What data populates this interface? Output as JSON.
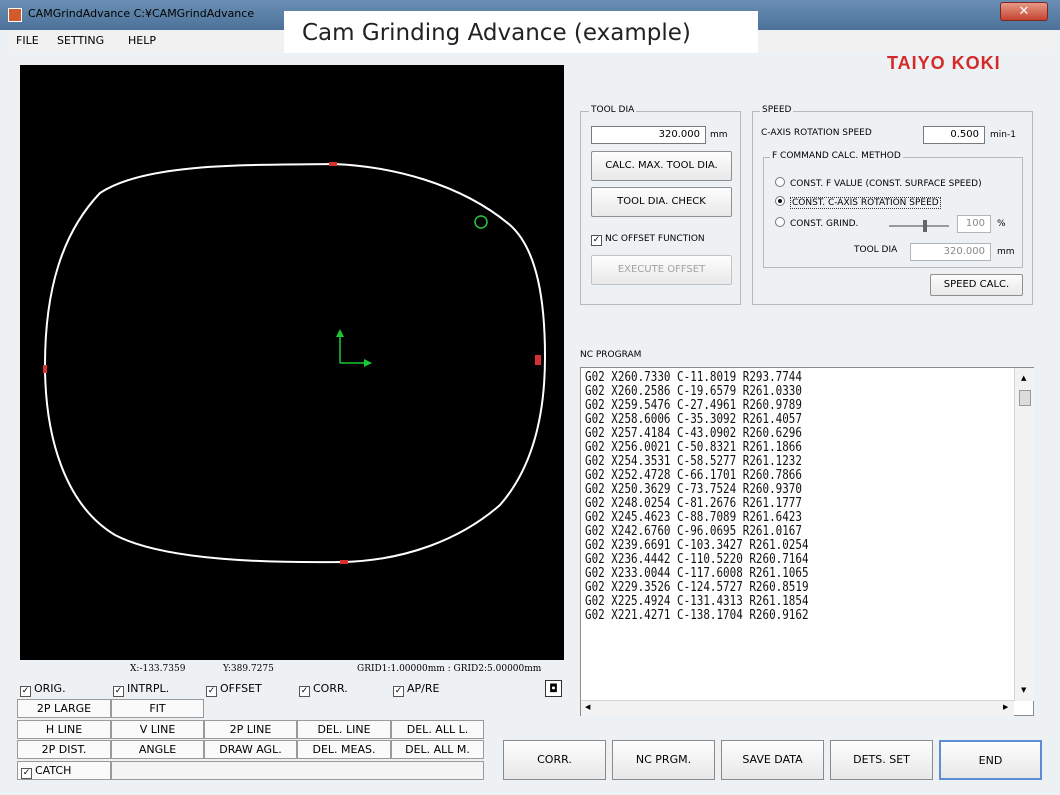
{
  "window": {
    "title": "CAMGrindAdvance  C:¥CAMGrindAdvance",
    "close_symbol": "✕",
    "caption_overlay": "Cam Grinding Advance (example)",
    "brand_logo": "TAIYO KOKI"
  },
  "menu": [
    "FILE",
    "SETTING",
    "HELP"
  ],
  "status": {
    "x": "X:-133.7359",
    "y": "Y:389.7275",
    "grid": "GRID1:1.00000mm : GRID2:5.00000mm"
  },
  "display_options": [
    {
      "label": "ORIG.",
      "checked": true
    },
    {
      "label": "INTRPL.",
      "checked": true
    },
    {
      "label": "OFFSET",
      "checked": true
    },
    {
      "label": "CORR.",
      "checked": true
    },
    {
      "label": "AP/RE",
      "checked": true
    }
  ],
  "catch": {
    "label": "CATCH",
    "checked": true
  },
  "tool_grid": {
    "row1": [
      "2P LARGE",
      "FIT"
    ],
    "row2": [
      "H LINE",
      "V LINE",
      "2P LINE",
      "DEL. LINE",
      "DEL. ALL L."
    ],
    "row3": [
      "2P DIST.",
      "ANGLE",
      "DRAW AGL.",
      "DEL. MEAS.",
      "DEL. ALL M."
    ]
  },
  "tool_dia": {
    "legend": "TOOL DIA",
    "value": "320.000",
    "unit": "mm",
    "calc_max_button": "CALC. MAX. TOOL DIA.",
    "check_button": "TOOL DIA. CHECK",
    "nc_offset_label": "NC OFFSET FUNCTION",
    "nc_offset_checked": true,
    "execute_button": "EXECUTE OFFSET"
  },
  "speed": {
    "legend": "SPEED",
    "c_axis_label": "C-AXIS ROTATION SPEED",
    "c_axis_value": "0.500",
    "c_axis_unit": "min-1",
    "method_legend": "F COMMAND CALC. METHOD",
    "options": [
      {
        "label": "CONST. F VALUE (CONST. SURFACE SPEED)",
        "selected": false
      },
      {
        "label": "CONST. C-AXIS ROTATION SPEED",
        "selected": true
      },
      {
        "label": "CONST. GRIND.",
        "selected": false
      }
    ],
    "grind_value": "100",
    "grind_unit": "%",
    "grind_level": 0.6,
    "tool_dia_label": "TOOL DIA",
    "tool_dia_value": "320.000",
    "tool_dia_unit": "mm",
    "calc_button": "SPEED CALC."
  },
  "nc_program": {
    "label": "NC PROGRAM",
    "lines": [
      "G02 X260.7330 C-11.8019 R293.7744",
      "G02 X260.2586 C-19.6579 R261.0330",
      "G02 X259.5476 C-27.4961 R260.9789",
      "G02 X258.6006 C-35.3092 R261.4057",
      "G02 X257.4184 C-43.0902 R260.6296",
      "G02 X256.0021 C-50.8321 R261.1866",
      "G02 X254.3531 C-58.5277 R261.1232",
      "G02 X252.4728 C-66.1701 R260.7866",
      "G02 X250.3629 C-73.7524 R260.9370",
      "G02 X248.0254 C-81.2676 R261.1777",
      "G02 X245.4623 C-88.7089 R261.6423",
      "G02 X242.6760 C-96.0695 R261.0167",
      "G02 X239.6691 C-103.3427 R261.0254",
      "G02 X236.4442 C-110.5220 R260.7164",
      "G02 X233.0044 C-117.6008 R261.1065",
      "G02 X229.3526 C-124.5727 R260.8519",
      "G02 X225.4924 C-131.4313 R261.1854",
      "G02 X221.4271 C-138.1704 R260.9162"
    ]
  },
  "bottom_buttons": [
    "CORR.",
    "NC PRGM.",
    "SAVE DATA",
    "DETS. SET",
    "END"
  ],
  "colors": {
    "brand": "#d42a2a",
    "profile": "#ffffff",
    "axis": "#19c832",
    "marker": "#d63030",
    "point_circle": "#28c43c"
  }
}
